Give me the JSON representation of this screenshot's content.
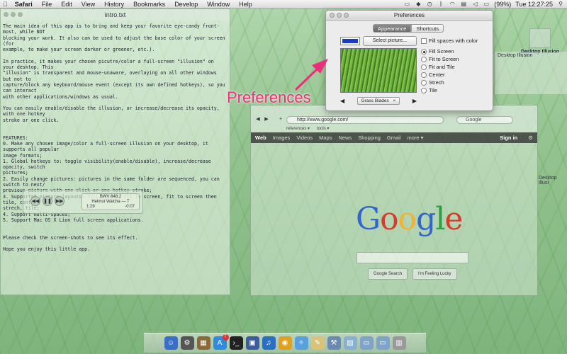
{
  "menubar": {
    "app_name": "Safari",
    "items": [
      "File",
      "Edit",
      "View",
      "History",
      "Bookmarks",
      "Develop",
      "Window",
      "Help"
    ],
    "battery": "(99%)",
    "clock": "Tue 12:27:25"
  },
  "text_window": {
    "title": "intro.txt",
    "body": "The main idea of this app is to bring and keep your favorite eye-candy front-most, while NOT\nblocking your work. It also can be used to adjust the base color of your screen (for\nexample, to make your screen darker or greener, etc.).\n\nIn practice, it makes your chosen picutre/color a full-screen \"illusion\" on your desktop. This\n\"illusion\" is transparent and mouse-unaware, overlaying on all other windows but not to\ncapture/block any keyboard/mouse event (except its own defined hotkeys), so you can interact\nwith other applications/windows as usual.\n\nYou can easily enable/disable the illusion, or increase/decrease its opacity, with one hotkey\nstroke or one click.\n\n\nFEATURES:\n0. Make any chosen image/color a full-screen illusion on your desktop, it supports all popular\nimage formats;\n1. Global hotkeys to: toggle visibility(enable/disable), increase/decrease opacity, switch\npictures;\n2. Easily change pictures: pictures in the same folder are sequenced, you can switch to next/\nprevious picture with one click or one hotkey stroke;\n3. Supported picture layouts: fill screen, fit to screen, fit to screen then tile, center,\nstrech, tile;\n4. Support multi-spaces;\n5. Support Mac OS X Lion full screen applications.\n\n\nPlease check the screen-shots to see its effect.\n\nHope you enjoy this little app."
  },
  "itunes": {
    "track": "BWV 848.2",
    "artist": "Helmut Walcha — T",
    "elapsed": "1:29",
    "remaining": "-0:07"
  },
  "browser": {
    "url": "http://www.google.com/",
    "search_placeholder": "Google",
    "bookmarks": [
      "references ▾",
      "tools ▾"
    ],
    "google_bar": [
      "Web",
      "Images",
      "Videos",
      "Maps",
      "News",
      "Shopping",
      "Gmail",
      "more ▾"
    ],
    "sign_in": "Sign in",
    "search_button": "Google Search",
    "lucky_button": "I'm Feeling Lucky",
    "logo": "Google",
    "logo_colors": [
      "#3366cc",
      "#d93a2b",
      "#f2b233",
      "#3366cc",
      "#2e9e3f",
      "#d93a2b"
    ]
  },
  "preferences": {
    "title": "Preferences",
    "tabs": [
      "Appearance",
      "Shortcuts"
    ],
    "select_button": "Select picture...",
    "fill_spaces_label": "Fill spaces with color",
    "swatch_color": "#1a3acc",
    "layouts": [
      "Fill Screen",
      "Fit to Screen",
      "Fit and Tile",
      "Center",
      "Strech",
      "Tile"
    ],
    "selected_layout": "Fill Screen",
    "picture_name": "Grass Blades",
    "picture_close": "×"
  },
  "annotation": {
    "label": "Preferences",
    "color": "#ec2f7b"
  },
  "desktop": {
    "icon_label_1": "Desktop Illusion",
    "window_label": "Desktop Illusion",
    "side_label": "Desktop Illusi"
  },
  "dock": {
    "badge": "7"
  }
}
